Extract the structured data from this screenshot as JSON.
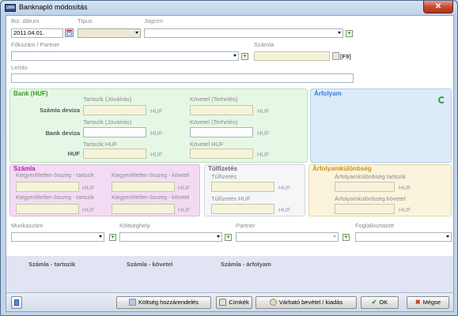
{
  "window": {
    "title": "Banknapló módosítás",
    "close_glyph": "✕",
    "app_icon_text": "1890"
  },
  "top": {
    "biz_datum_label": "Biz. dátum",
    "biz_datum_value": "2011.04.01.",
    "tipus_label": "Típus",
    "tipus_value": "",
    "jogcim_label": "Jogcím",
    "jogcim_value": "",
    "fokszam_label": "Főkszám / Partner",
    "fokszam_value": "",
    "szamla_label": "Számla",
    "szamla_value": "",
    "f9_label": "[F9]",
    "leiras_label": "Leírás",
    "leiras_value": ""
  },
  "bank": {
    "title": "Bank (HUF)",
    "col_tartozik": "Tartozik (Jóváírás)",
    "col_kovetel": "Követel (Terhelés)",
    "row1_label": "Számla deviza",
    "row2_label": "Bank deviza",
    "row3_label": "HUF",
    "col_tartozik_huf": "Tartozik HUF",
    "col_kovetel_huf": "Követel HUF",
    "unit": "HUF"
  },
  "arfolyam": {
    "title": "Árfolyam"
  },
  "szamla": {
    "title": "Számla",
    "kiegy_tartozik": "Kiegyenlítetlen összeg - tartozik",
    "kiegy_kovetel": "Kiegyenlítetlen összeg - követel",
    "unit": "HUF"
  },
  "tulfizetes": {
    "title": "Túlfizetés",
    "field1": "Túlfizetés",
    "field2": "Túlfizetés HUF",
    "unit": "HUF"
  },
  "arfolyamkulonbseg": {
    "title": "Árfolyamkülönbség",
    "field1": "Árfolyamkülönbség tartozik",
    "field2": "Árfolyamkülönbség követel",
    "unit": "HUF"
  },
  "lower": {
    "munkaszam_label": "Munkaszám",
    "koltseghely_label": "Költséghely",
    "partner_label": "Partner",
    "foglalkoztatott_label": "Foglalkoztatott"
  },
  "band": {
    "col1": "Számla - tartozik",
    "col2": "Számla - követel",
    "col3": "Számla - árfolyam"
  },
  "footer": {
    "koltseg_btn": "Költség hozzárendelés",
    "cimkek_btn": "Címkék",
    "varhato_btn": "Várható bevétel / kiadás",
    "ok_btn": "OK",
    "megse_btn": "Mégse"
  },
  "colors": {
    "bank_bg": "#e6f7e6",
    "bank_title": "#3a9a2a",
    "arfolyam_bg": "#dcebfa",
    "arfolyam_title": "#3a7ad8",
    "szamla_bg": "#f3dcf3",
    "szamla_title": "#b020b0",
    "tulfizetes_bg": "#f5f6f8",
    "tulfizetes_title": "#666666",
    "arfkul_bg": "#fbf4dc",
    "arfkul_title": "#c89020"
  }
}
